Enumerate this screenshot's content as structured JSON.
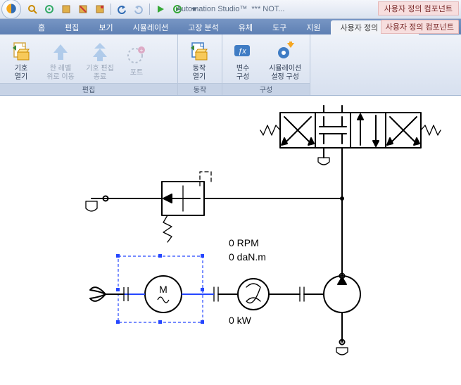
{
  "titlebar": {
    "app_name": "Automation Studio™",
    "doc_status": "*** NOT...",
    "pink_top_label": "사용자 정의 컴포넌트"
  },
  "tabs": {
    "items": [
      {
        "label": "홈"
      },
      {
        "label": "편집"
      },
      {
        "label": "보기"
      },
      {
        "label": "시뮬레이션"
      },
      {
        "label": "고장 분석"
      },
      {
        "label": "유체"
      },
      {
        "label": "도구"
      },
      {
        "label": "지원"
      },
      {
        "label": "사용자 정의 컴포넌트",
        "active": true
      }
    ],
    "pink_help_label": "사용자 정의 컴포넌트"
  },
  "ribbon": {
    "groups": [
      {
        "name": "편집",
        "buttons": [
          {
            "id": "open-symbol",
            "label": "기호\n열기",
            "icon": "doc-folder",
            "disabled": false
          },
          {
            "id": "up-level",
            "label": "한 레벨\n위로 이동",
            "icon": "arrow-up",
            "disabled": true
          },
          {
            "id": "finish-edit",
            "label": "기호 편집\n종료",
            "icon": "dbl-arrow-up",
            "disabled": true
          },
          {
            "id": "ports",
            "label": "포트",
            "icon": "port-circle",
            "disabled": true
          }
        ]
      },
      {
        "name": "동작",
        "buttons": [
          {
            "id": "open-behavior",
            "label": "동작\n열기",
            "icon": "doc-gear",
            "disabled": false
          }
        ]
      },
      {
        "name": "구성",
        "buttons": [
          {
            "id": "var-config",
            "label": "변수\n구성",
            "icon": "var-fx",
            "disabled": false
          },
          {
            "id": "sim-config",
            "label": "시뮬레이션\n설정 구성",
            "icon": "gear-orange",
            "disabled": false
          }
        ]
      }
    ]
  },
  "diagram": {
    "readouts": {
      "rpm": "0 RPM",
      "torque": "0 daN.m",
      "power": "0 kW"
    },
    "motor_label": "M"
  }
}
